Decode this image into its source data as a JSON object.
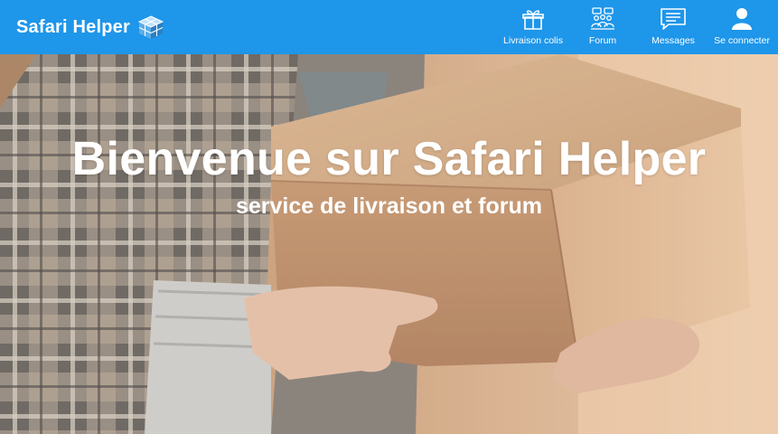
{
  "header": {
    "brand": "Safari Helper",
    "brand_logo_icon": "cube-logo-icon",
    "background_color": "#1e96ea",
    "nav": [
      {
        "label": "Livraison colis",
        "icon": "gift-box-icon"
      },
      {
        "label": "Forum",
        "icon": "community-icon"
      },
      {
        "label": "Messages",
        "icon": "message-icon"
      },
      {
        "label": "Se connecter",
        "icon": "user-icon"
      }
    ]
  },
  "hero": {
    "title": "Bienvenue sur Safari Helper",
    "subtitle": "service de livraison et forum",
    "image": "person holding cardboard delivery box"
  }
}
